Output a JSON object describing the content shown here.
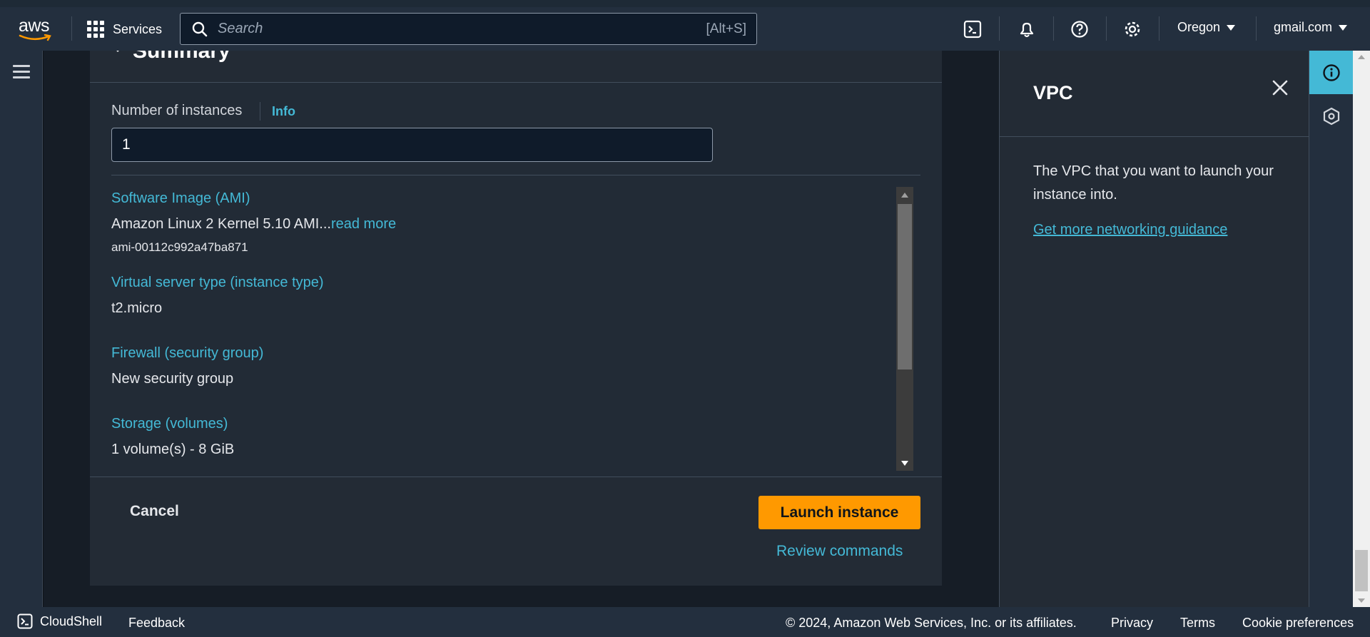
{
  "topnav": {
    "logo_text": "aws",
    "services_label": "Services",
    "search_placeholder": "Search",
    "search_shortcut": "[Alt+S]",
    "region": "Oregon",
    "account": "gmail.com",
    "icons": [
      "cloudshell-icon",
      "bell-icon",
      "help-icon",
      "gear-icon"
    ]
  },
  "summary": {
    "title": "Summary",
    "number_of_instances_label": "Number of instances",
    "info_label": "Info",
    "number_of_instances_value": "1",
    "items": [
      {
        "key": "Software Image (AMI)",
        "value": "Amazon Linux 2 Kernel 5.10 AMI...",
        "more": "read more",
        "sub": "ami-00112c992a47ba871"
      },
      {
        "key": "Virtual server type (instance type)",
        "value": "t2.micro"
      },
      {
        "key": "Firewall (security group)",
        "value": "New security group"
      },
      {
        "key": "Storage (volumes)",
        "value": "1 volume(s) - 8 GiB"
      }
    ],
    "cancel_label": "Cancel",
    "launch_label": "Launch instance",
    "review_label": "Review commands"
  },
  "help_panel": {
    "title": "VPC",
    "description": "The VPC that you want to launch your instance into.",
    "link": "Get more networking guidance"
  },
  "footer": {
    "cloudshell": "CloudShell",
    "feedback": "Feedback",
    "copyright": "© 2024, Amazon Web Services, Inc. or its affiliates.",
    "privacy": "Privacy",
    "terms": "Terms",
    "cookies": "Cookie preferences"
  },
  "colors": {
    "accent_link": "#44b9d6",
    "primary_button": "#ff9900",
    "nav_bg": "#232f3e"
  }
}
